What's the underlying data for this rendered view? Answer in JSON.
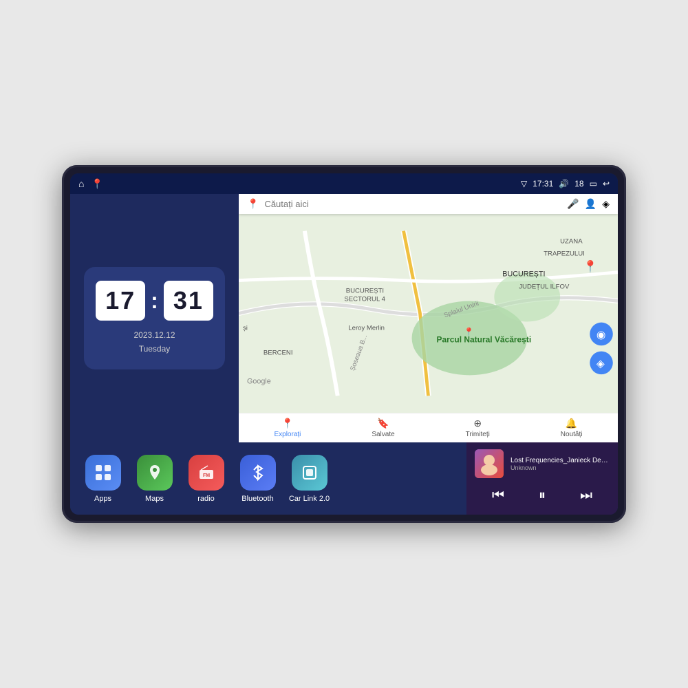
{
  "device": {
    "status_bar": {
      "left_icons": [
        "home",
        "maps"
      ],
      "time": "17:31",
      "signal_icon": "▽",
      "volume_icon": "🔊",
      "volume_level": "18",
      "battery_icon": "▭",
      "back_icon": "↩"
    },
    "clock": {
      "hour": "17",
      "minute": "31",
      "date": "2023.12.12",
      "day": "Tuesday"
    },
    "map": {
      "search_placeholder": "Căutați aici",
      "bottom_items": [
        {
          "label": "Explorați",
          "icon": "📍",
          "active": true
        },
        {
          "label": "Salvate",
          "icon": "🔖",
          "active": false
        },
        {
          "label": "Trimiteți",
          "icon": "⊕",
          "active": false
        },
        {
          "label": "Noutăți",
          "icon": "🔔",
          "active": false
        }
      ]
    },
    "apps": [
      {
        "id": "apps",
        "label": "Apps",
        "icon": "⊞",
        "color_class": "apps-icon"
      },
      {
        "id": "maps",
        "label": "Maps",
        "icon": "📍",
        "color_class": "maps-icon"
      },
      {
        "id": "radio",
        "label": "radio",
        "icon": "📻",
        "color_class": "radio-icon"
      },
      {
        "id": "bluetooth",
        "label": "Bluetooth",
        "icon": "₿",
        "color_class": "bluetooth-icon"
      },
      {
        "id": "carlink",
        "label": "Car Link 2.0",
        "icon": "📱",
        "color_class": "carlink-icon"
      }
    ],
    "music": {
      "title": "Lost Frequencies_Janieck Devy-...",
      "artist": "Unknown",
      "prev_label": "⏮",
      "play_label": "⏸",
      "next_label": "⏭"
    }
  }
}
